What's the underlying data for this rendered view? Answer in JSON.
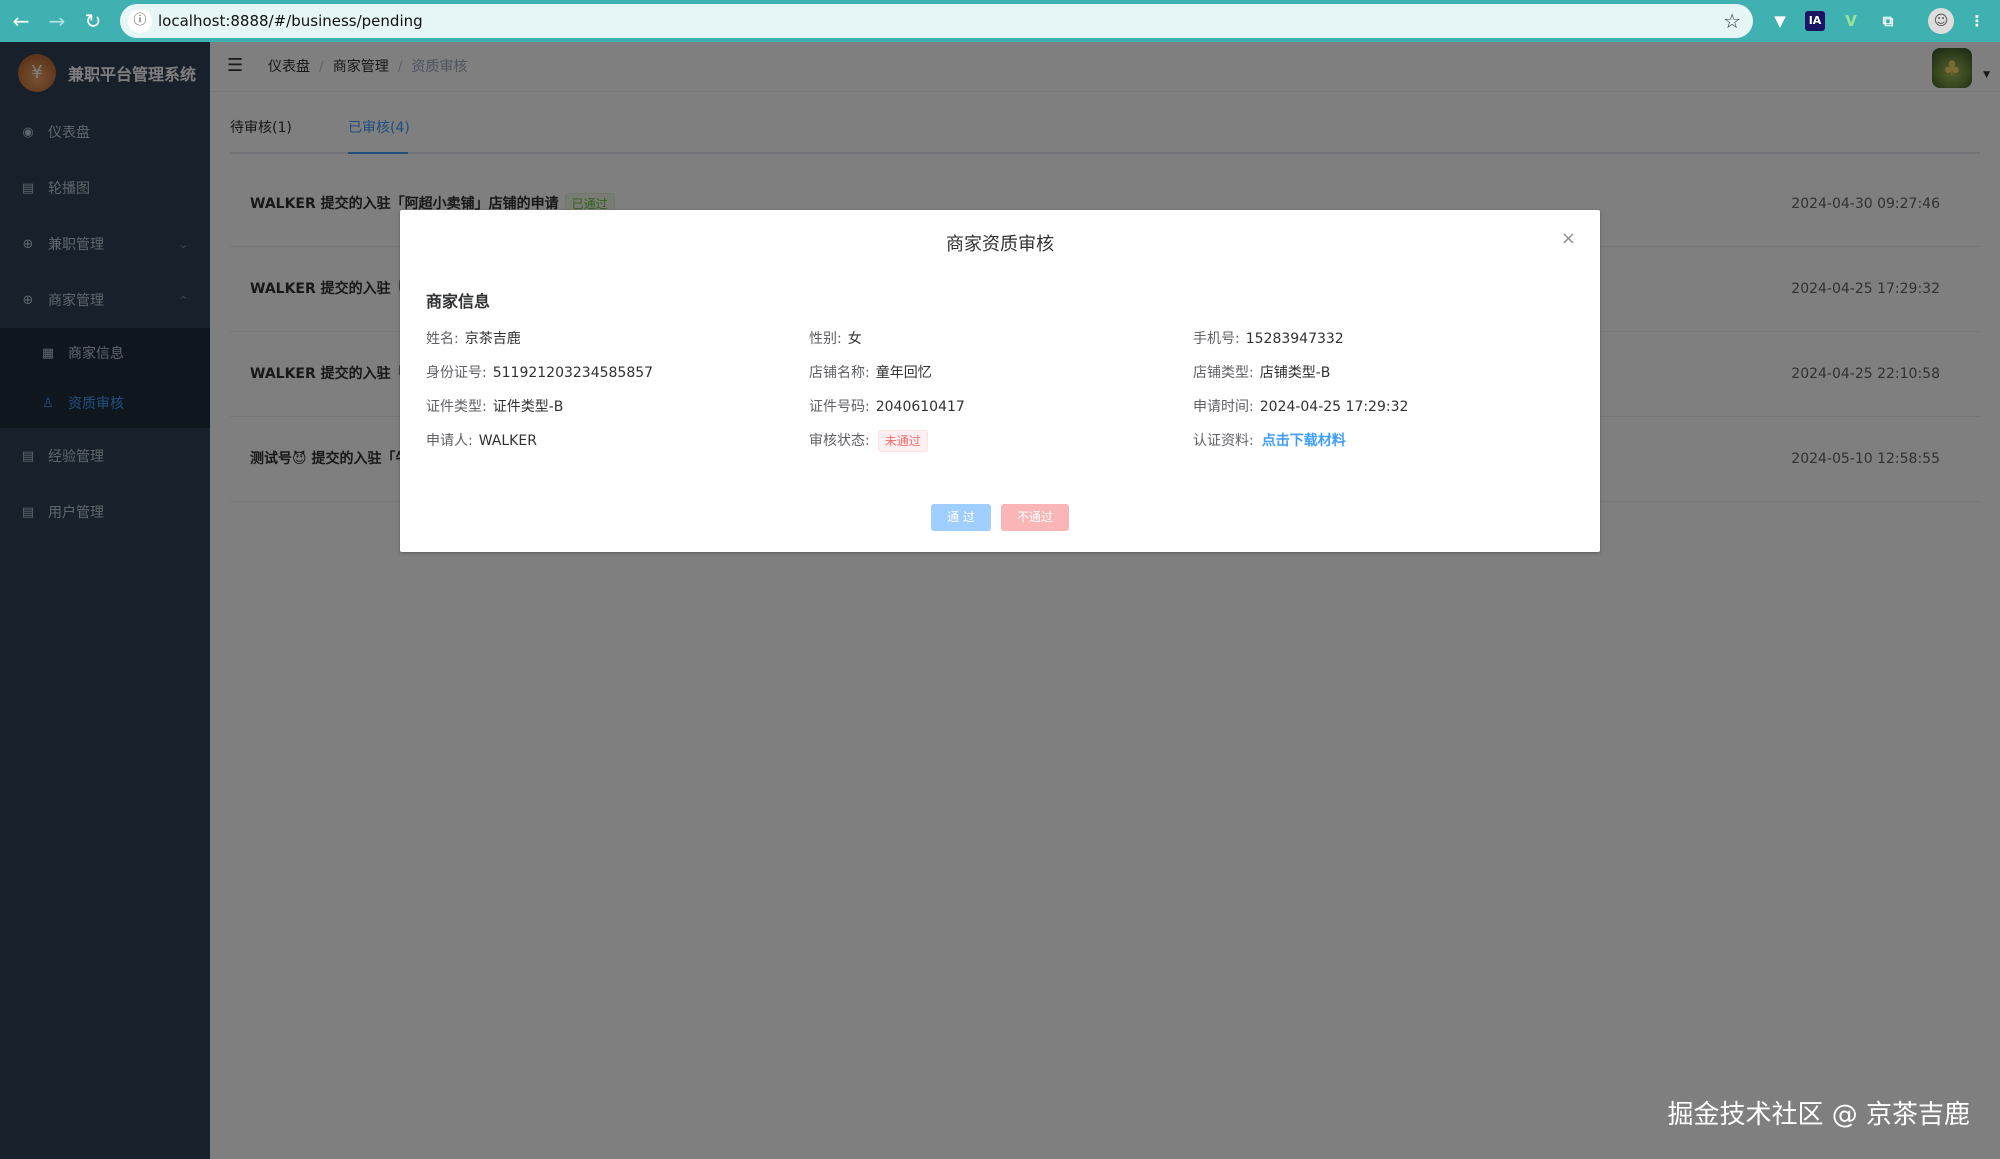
{
  "browser": {
    "url": "localhost:8888/#/business/pending"
  },
  "sidebar": {
    "brand": "兼职平台管理系统",
    "items": [
      {
        "label": "仪表盘"
      },
      {
        "label": "轮播图"
      },
      {
        "label": "兼职管理"
      },
      {
        "label": "商家管理"
      },
      {
        "label": "经验管理"
      },
      {
        "label": "用户管理"
      }
    ],
    "sub_items": [
      {
        "label": "商家信息"
      },
      {
        "label": "资质审核"
      }
    ]
  },
  "breadcrumb": [
    "仪表盘",
    "商家管理",
    "资质审核"
  ],
  "tabs": [
    {
      "label": "待审核(1)"
    },
    {
      "label": "已审核(4)"
    }
  ],
  "list": [
    {
      "msg": "WALKER 提交的入驻「阿超小卖铺」店铺的申请",
      "tag": "已通过",
      "time": "2024-04-30 09:27:46"
    },
    {
      "msg": "WALKER 提交的入驻「童",
      "time": "2024-04-25 17:29:32"
    },
    {
      "msg": "WALKER 提交的入驻「AI",
      "time": "2024-04-25 22:10:58"
    },
    {
      "msg": "测试号😈 提交的入驻「牛",
      "time": "2024-05-10 12:58:55"
    }
  ],
  "dialog": {
    "title": "商家资质审核",
    "close": "×",
    "section": "商家信息",
    "fields": {
      "name_label": "姓名:",
      "name": "京茶吉鹿",
      "gender_label": "性别:",
      "gender": "女",
      "phone_label": "手机号:",
      "phone": "15283947332",
      "id_label": "身份证号:",
      "id": "511921203234585857",
      "shop_name_label": "店铺名称:",
      "shop_name": "童年回忆",
      "shop_type_label": "店铺类型:",
      "shop_type": "店铺类型-B",
      "cert_type_label": "证件类型:",
      "cert_type": "证件类型-B",
      "cert_no_label": "证件号码:",
      "cert_no": "2040610417",
      "apply_time_label": "申请时间:",
      "apply_time": "2024-04-25 17:29:32",
      "applicant_label": "申请人:",
      "applicant": "WALKER",
      "status_label": "审核状态:",
      "status": "未通过",
      "material_label": "认证资料:",
      "material_link": "点击下载材料"
    },
    "pass_button": "通 过",
    "reject_button": "不通过"
  },
  "watermark": "掘金技术社区 @ 京茶吉鹿",
  "colors": {
    "chrome": "#3fb1b1",
    "sidebar": "#304156",
    "primary": "#409eff",
    "danger": "#f56c6c",
    "success": "#67c23a"
  }
}
